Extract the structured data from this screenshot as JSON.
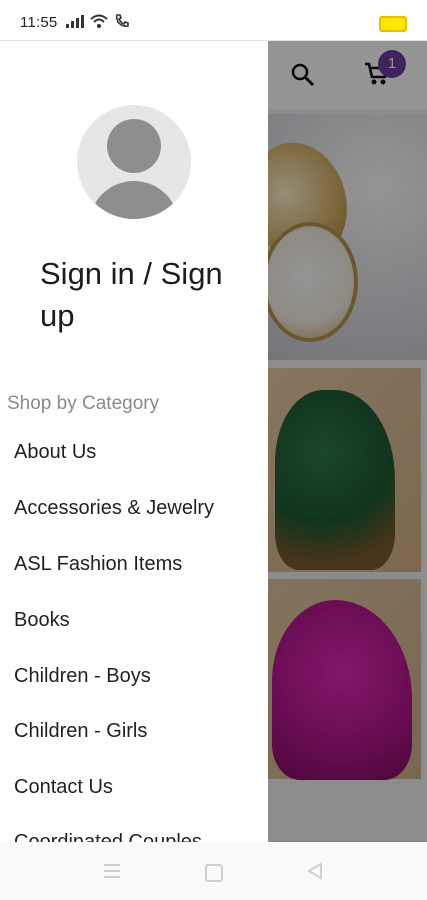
{
  "status_bar": {
    "time": "11:55",
    "icons": [
      "signal-icon",
      "wifi-icon",
      "call-icon",
      "battery-icon"
    ],
    "battery_color": "#ffe600"
  },
  "app_bar": {
    "cart_count": "1",
    "badge_color": "#6b3fa0",
    "icons": [
      "search-icon",
      "cart-icon"
    ]
  },
  "drawer": {
    "sign_in_label": "Sign in / Sign up",
    "section_label": "Shop by Category",
    "items": [
      "About Us",
      "Accessories & Jewelry",
      "ASL Fashion Items",
      "Books",
      "Children - Boys",
      "Children - Girls",
      "Contact Us",
      "Coordinated Couples"
    ]
  },
  "nav_bar": {
    "icons": [
      "menu-icon",
      "home-square-icon",
      "back-triangle-icon"
    ]
  }
}
